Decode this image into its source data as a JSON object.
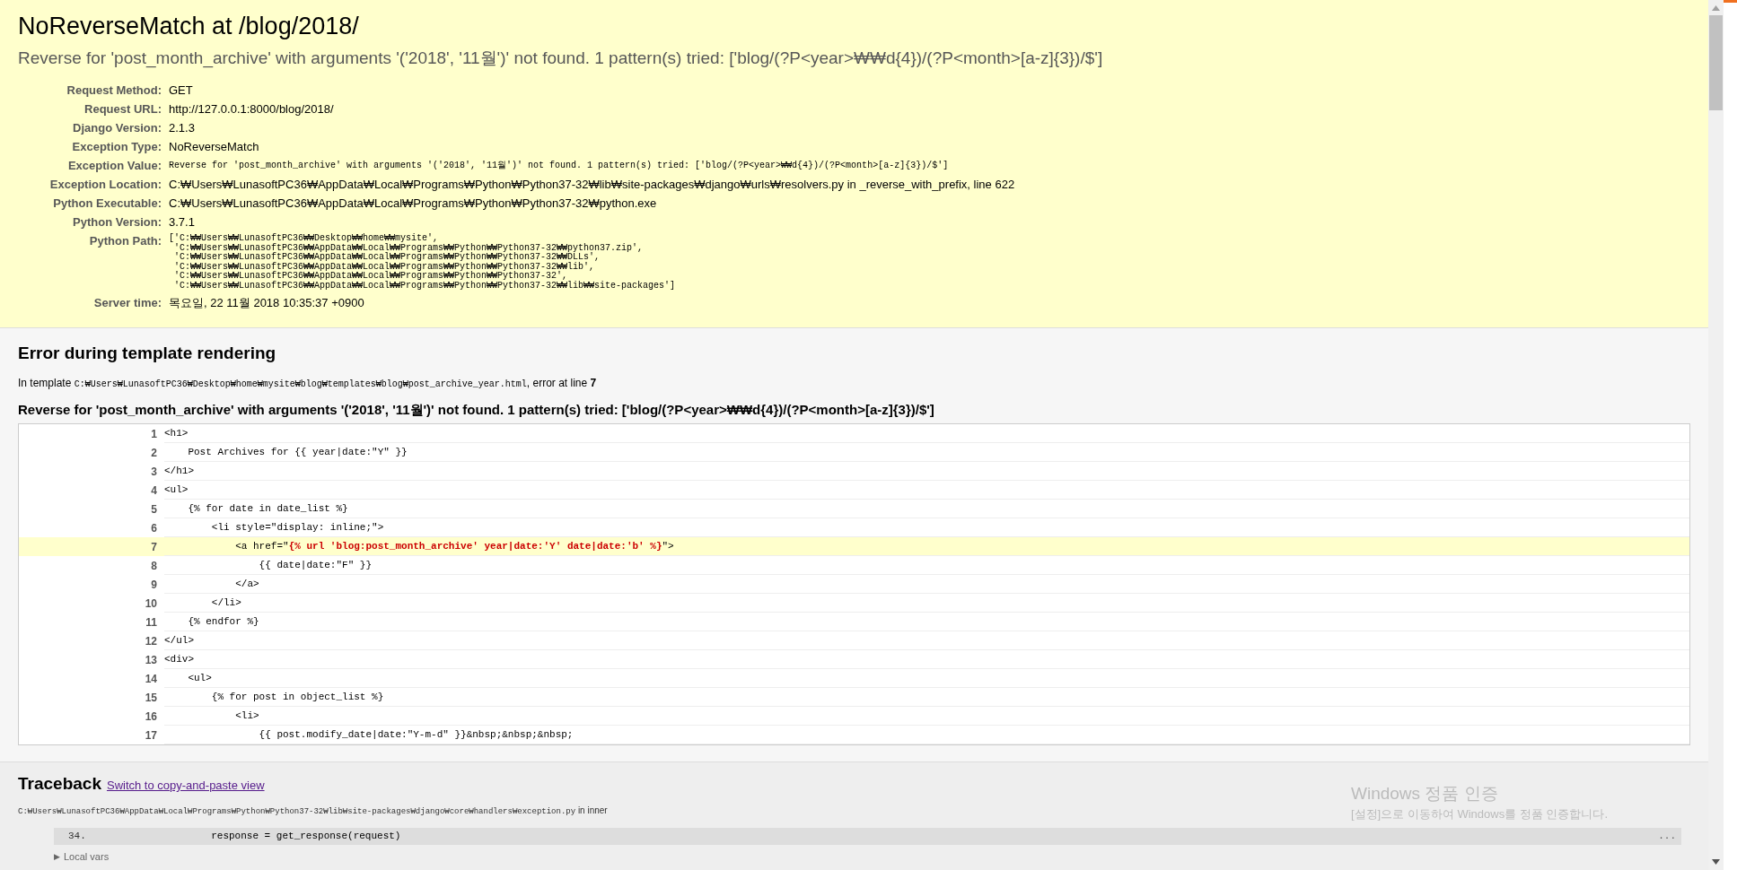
{
  "title": "NoReverseMatch at /blog/2018/",
  "exception_message": "Reverse for 'post_month_archive' with arguments '('2018', '11월')' not found. 1 pattern(s) tried: ['blog/(?P<year>₩₩d{4})/(?P<month>[a-z]{3})/$']",
  "summary": [
    {
      "label": "Request Method:",
      "kind": "text",
      "value": "GET"
    },
    {
      "label": "Request URL:",
      "kind": "text",
      "value": "http://127.0.0.1:8000/blog/2018/"
    },
    {
      "label": "Django Version:",
      "kind": "text",
      "value": "2.1.3"
    },
    {
      "label": "Exception Type:",
      "kind": "text",
      "value": "NoReverseMatch"
    },
    {
      "label": "Exception Value:",
      "kind": "code",
      "value": "Reverse for 'post_month_archive' with arguments '('2018', '11월')' not found. 1 pattern(s) tried: ['blog/(?P<year>₩₩d{4})/(?P<month>[a-z]{3})/$']"
    },
    {
      "label": "Exception Location:",
      "kind": "text",
      "value": "C:₩Users₩LunasoftPC36₩AppData₩Local₩Programs₩Python₩Python37-32₩lib₩site-packages₩django₩urls₩resolvers.py in _reverse_with_prefix, line 622"
    },
    {
      "label": "Python Executable:",
      "kind": "text",
      "value": "C:₩Users₩LunasoftPC36₩AppData₩Local₩Programs₩Python₩Python37-32₩python.exe"
    },
    {
      "label": "Python Version:",
      "kind": "text",
      "value": "3.7.1"
    },
    {
      "label": "Python Path:",
      "kind": "lines",
      "lines": [
        "['C:₩₩Users₩₩LunasoftPC36₩₩Desktop₩₩home₩₩mysite',",
        " 'C:₩₩Users₩₩LunasoftPC36₩₩AppData₩₩Local₩₩Programs₩₩Python₩₩Python37-32₩₩python37.zip',",
        " 'C:₩₩Users₩₩LunasoftPC36₩₩AppData₩₩Local₩₩Programs₩₩Python₩₩Python37-32₩₩DLLs',",
        " 'C:₩₩Users₩₩LunasoftPC36₩₩AppData₩₩Local₩₩Programs₩₩Python₩₩Python37-32₩₩lib',",
        " 'C:₩₩Users₩₩LunasoftPC36₩₩AppData₩₩Local₩₩Programs₩₩Python₩₩Python37-32',",
        " 'C:₩₩Users₩₩LunasoftPC36₩₩AppData₩₩Local₩₩Programs₩₩Python₩₩Python37-32₩₩lib₩₩site-packages']"
      ]
    },
    {
      "label": "Server time:",
      "kind": "text",
      "value": "목요일, 22 11월 2018 10:35:37 +0900"
    }
  ],
  "template": {
    "heading": "Error during template rendering",
    "intro": "In template",
    "path": "C:₩Users₩LunasoftPC36₩Desktop₩home₩mysite₩blog₩templates₩blog₩post_archive_year.html",
    "error_at": ", error at line",
    "error_line": "7",
    "message": "Reverse for 'post_month_archive' with arguments '('2018', '11월')' not found. 1 pattern(s) tried: ['blog/(?P<year>₩₩d{4})/(?P<month>[a-z]{3})/$']",
    "lines": [
      {
        "number": "1",
        "code": "<h1>",
        "selected": false
      },
      {
        "number": "2",
        "code": "    Post Archives for {{ year|date:\"Y\" }}",
        "selected": false
      },
      {
        "number": "3",
        "code": "</h1>",
        "selected": false
      },
      {
        "number": "4",
        "code": "<ul>",
        "selected": false
      },
      {
        "number": "5",
        "code": "    {% for date in date_list %}",
        "selected": false
      },
      {
        "number": "6",
        "code": "        <li style=\"display: inline;\">",
        "selected": false
      },
      {
        "number": "7",
        "code": "            <a href=\"",
        "error": "{% url 'blog:post_month_archive' year|date:'Y' date|date:'b' %}",
        "after": "\">",
        "selected": true
      },
      {
        "number": "8",
        "code": "                {{ date|date:\"F\" }}",
        "selected": false
      },
      {
        "number": "9",
        "code": "            </a>",
        "selected": false
      },
      {
        "number": "10",
        "code": "        </li>",
        "selected": false
      },
      {
        "number": "11",
        "code": "    {% endfor %}",
        "selected": false
      },
      {
        "number": "12",
        "code": "</ul>",
        "selected": false
      },
      {
        "number": "13",
        "code": "<div>",
        "selected": false
      },
      {
        "number": "14",
        "code": "    <ul>",
        "selected": false
      },
      {
        "number": "15",
        "code": "        {% for post in object_list %}",
        "selected": false
      },
      {
        "number": "16",
        "code": "            <li>",
        "selected": false
      },
      {
        "number": "17",
        "code": "                {{ post.modify_date|date:\"Y-m-d\" }}&nbsp;&nbsp;&nbsp;",
        "selected": false
      }
    ]
  },
  "traceback": {
    "heading": "Traceback",
    "toggle_link": "Switch to copy-and-paste view",
    "frames": [
      {
        "path": "C:₩Users₩LunasoftPC36₩AppData₩Local₩Programs₩Python₩Python37-32₩lib₩site-packages₩django₩core₩handlers₩exception.py",
        "in": "in",
        "function": "inner",
        "line_number": "34.",
        "code": "            response = get_response(request)",
        "ellipsis": "...",
        "toggle": "▶",
        "local_vars": "Local vars"
      }
    ]
  },
  "activation_notice": {
    "title": "Windows 정품 인증",
    "message": "[설정]으로 이동하여 Windows를 정품 인증합니다."
  }
}
